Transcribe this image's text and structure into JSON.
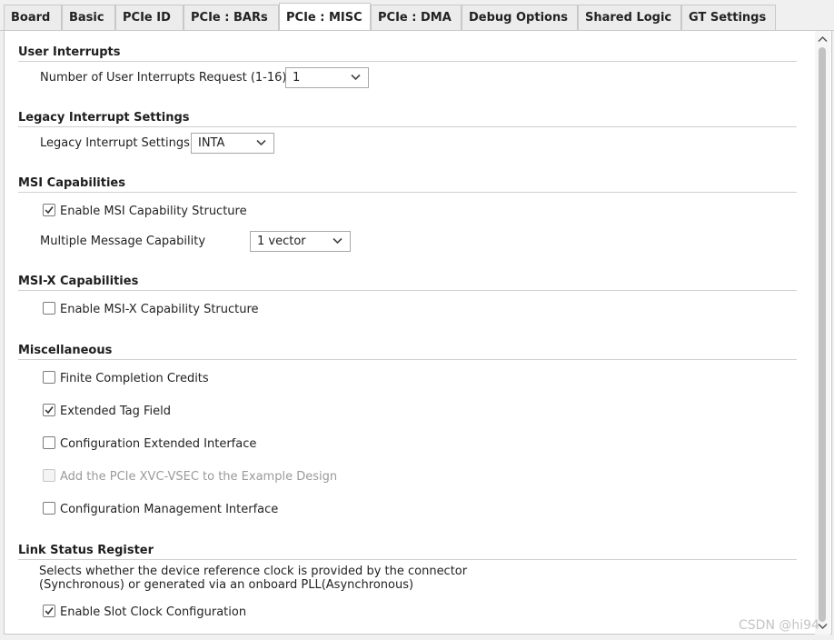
{
  "tabs": [
    {
      "label": "Board"
    },
    {
      "label": "Basic"
    },
    {
      "label": "PCIe ID"
    },
    {
      "label": "PCIe : BARs"
    },
    {
      "label": "PCIe : MISC",
      "active": true
    },
    {
      "label": "PCIe : DMA"
    },
    {
      "label": "Debug Options"
    },
    {
      "label": "Shared Logic"
    },
    {
      "label": "GT Settings"
    }
  ],
  "sections": {
    "user_interrupts": {
      "title": "User Interrupts",
      "num_label": "Number of User Interrupts Request (1-16)",
      "num_value": "1"
    },
    "legacy": {
      "title": "Legacy Interrupt Settings",
      "label": "Legacy Interrupt Settings",
      "value": "INTA"
    },
    "msi": {
      "title": "MSI Capabilities",
      "enable_label": "Enable MSI Capability Structure",
      "enable_checked": true,
      "mmc_label": "Multiple Message Capability",
      "mmc_value": "1 vector"
    },
    "msix": {
      "title": "MSI-X Capabilities",
      "enable_label": "Enable MSI-X Capability Structure",
      "enable_checked": false
    },
    "misc": {
      "title": "Miscellaneous",
      "items": [
        {
          "label": "Finite Completion Credits",
          "checked": false,
          "disabled": false
        },
        {
          "label": "Extended Tag Field",
          "checked": true,
          "disabled": false
        },
        {
          "label": "Configuration Extended Interface",
          "checked": false,
          "disabled": false
        },
        {
          "label": "Add the PCIe XVC-VSEC to the Example Design",
          "checked": false,
          "disabled": true
        },
        {
          "label": "Configuration Management Interface",
          "checked": false,
          "disabled": false
        }
      ]
    },
    "link_status": {
      "title": "Link Status Register",
      "desc_line1": "Selects whether the device reference clock is provided by the connector",
      "desc_line2": "(Synchronous) or generated via an onboard PLL(Asynchronous)",
      "enable_label": "Enable Slot Clock Configuration",
      "enable_checked": true
    }
  },
  "watermark": "CSDN @hi94"
}
